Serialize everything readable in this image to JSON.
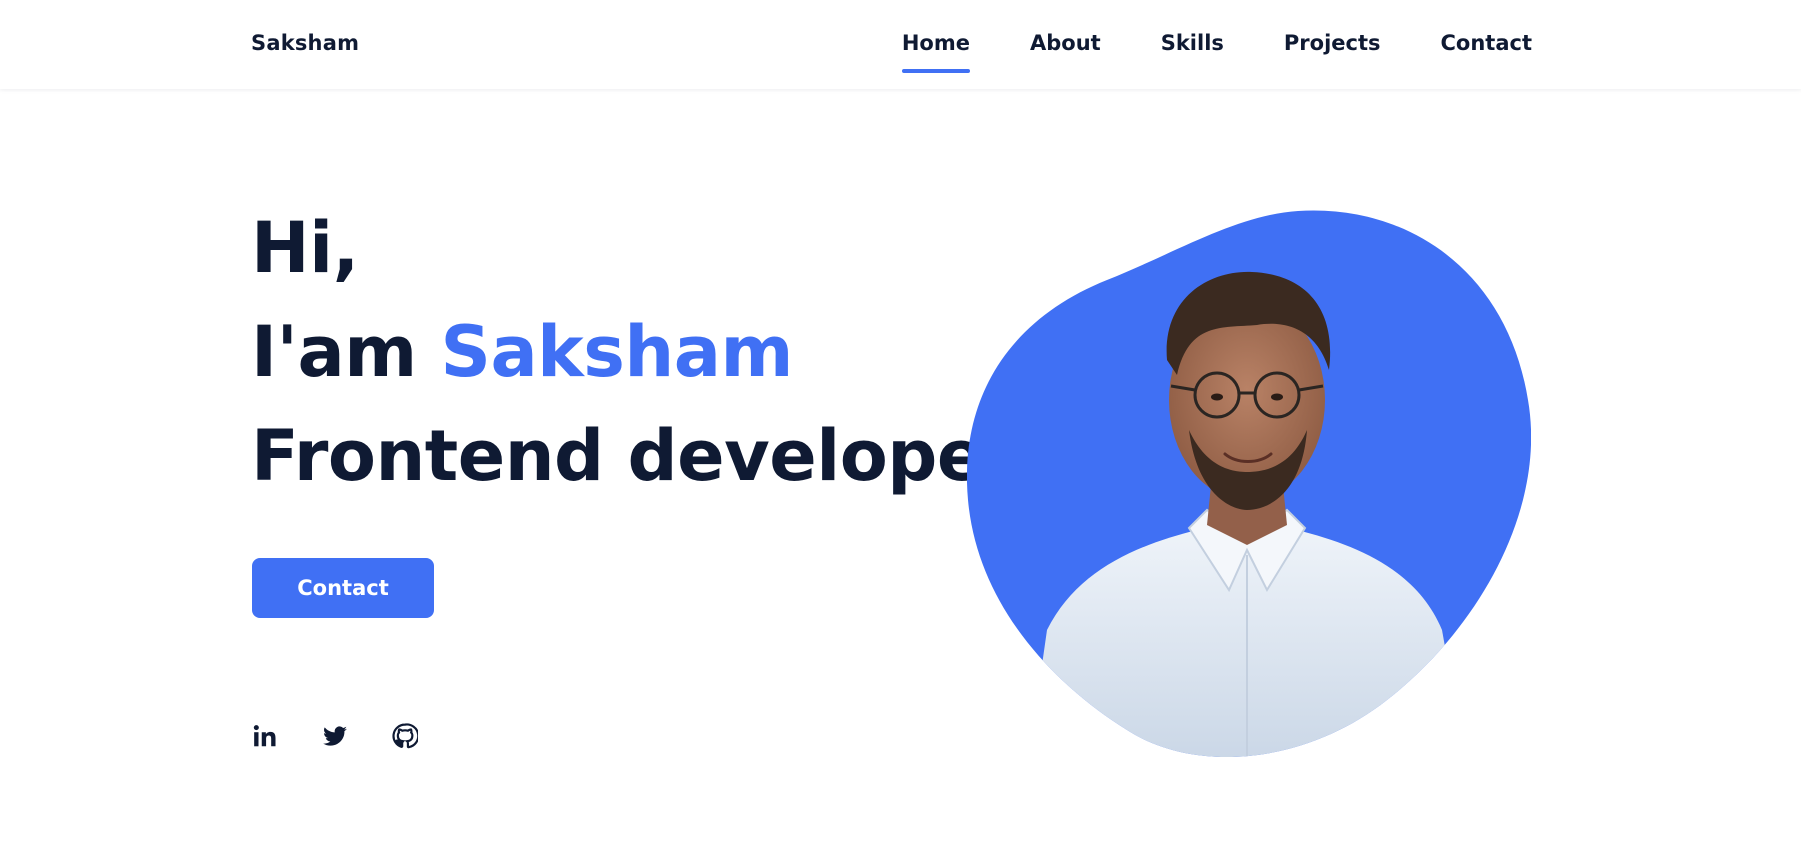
{
  "header": {
    "brand": "Saksham",
    "nav": [
      {
        "label": "Home",
        "active": true
      },
      {
        "label": "About",
        "active": false
      },
      {
        "label": "Skills",
        "active": false
      },
      {
        "label": "Projects",
        "active": false
      },
      {
        "label": "Contact",
        "active": false
      }
    ]
  },
  "hero": {
    "greeting": "Hi,",
    "intro_prefix": "I'am",
    "name": "Saksham",
    "role": "Frontend developer",
    "cta_label": "Contact"
  },
  "socials": [
    {
      "icon": "linkedin-icon"
    },
    {
      "icon": "twitter-icon"
    },
    {
      "icon": "github-icon"
    }
  ],
  "colors": {
    "accent": "#4070f4",
    "text": "#0f1a33",
    "background": "#ffffff"
  }
}
